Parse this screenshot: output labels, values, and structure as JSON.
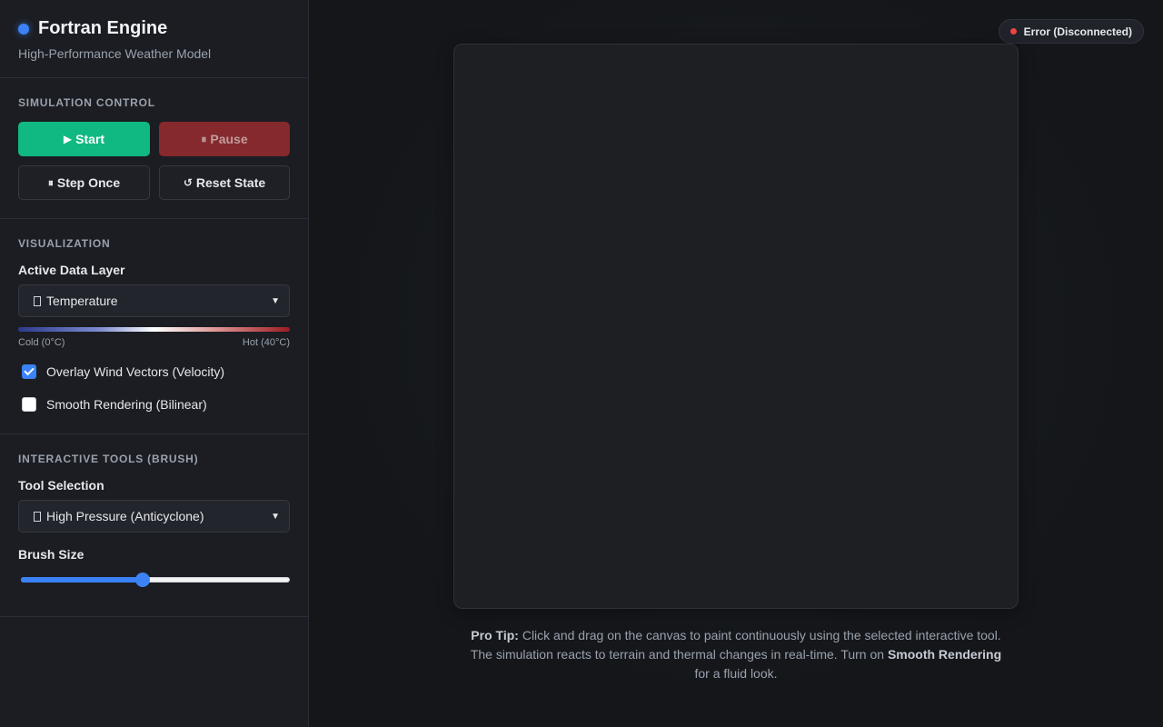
{
  "sidebar": {
    "brand": {
      "title": "Fortran Engine",
      "subtitle": "High-Performance Weather Model",
      "dot_color": "#3b82f6"
    },
    "simulation": {
      "title": "SIMULATION CONTROL",
      "start_label": "Start",
      "start_glyph": "▶",
      "pause_label": "Pause",
      "pause_glyph": "⏸",
      "step_label": "Step Once",
      "step_glyph": "⏸",
      "reset_label": "Reset State",
      "reset_glyph": "↺",
      "start_color": "#10b981",
      "pause_color": "#8b2a2e"
    },
    "visualization": {
      "title": "VISUALIZATION",
      "layer_label": "Active Data Layer",
      "layer_selected": "Temperature",
      "legend_cold": "Cold (0°C)",
      "legend_hot": "Hot (40°C)",
      "wind_label": "Overlay Wind Vectors (Velocity)",
      "wind_checked": true,
      "smooth_label": "Smooth Rendering (Bilinear)",
      "smooth_checked": false
    },
    "tools": {
      "title": "INTERACTIVE TOOLS (BRUSH)",
      "tool_label": "Tool Selection",
      "tool_selected": "High Pressure (Anticyclone)",
      "brush_label": "Brush Size",
      "brush_value_fraction": 0.45
    }
  },
  "main": {
    "status": {
      "text": "Error (Disconnected)",
      "color": "#ef4444"
    },
    "tip": {
      "lead": "Pro Tip:",
      "part1": " Click and drag on the canvas to paint continuously using the selected interactive tool. The simulation reacts to terrain and thermal changes in real-time. Turn on ",
      "emph": "Smooth Rendering",
      "part2": " for a fluid look."
    }
  }
}
